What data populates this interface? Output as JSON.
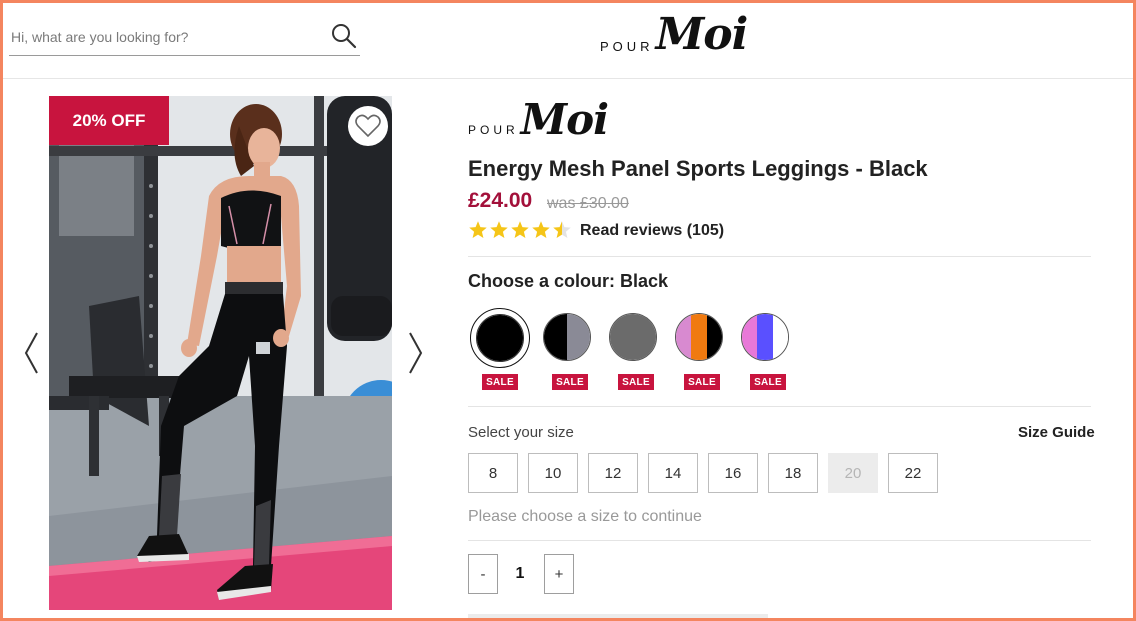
{
  "header": {
    "search_placeholder": "Hi, what are you looking for?",
    "logo_pour": "POUR",
    "logo_moi": "Moi"
  },
  "gallery": {
    "discount_badge": "20% OFF"
  },
  "product": {
    "brand_pour": "POUR",
    "brand_moi": "Moi",
    "title": "Energy Mesh Panel Sports Leggings - Black",
    "price": "£24.00",
    "was_price": "was £30.00",
    "rating": 4.5,
    "rating_max": 5,
    "reviews_link": "Read reviews (105)",
    "colour_label": "Choose a colour: Black",
    "colours": [
      {
        "name": "Black",
        "fill": [
          "#000000"
        ],
        "badge": "SALE",
        "selected": true
      },
      {
        "name": "Black/Grey",
        "fill": [
          "#000000",
          "#8a8a96"
        ],
        "badge": "SALE",
        "selected": false
      },
      {
        "name": "Grey",
        "fill": [
          "#6b6b6b"
        ],
        "badge": "SALE",
        "selected": false
      },
      {
        "name": "Pink/Orange/Black",
        "fill": [
          "#d88ad0",
          "#f07a10",
          "#000000"
        ],
        "badge": "SALE",
        "selected": false
      },
      {
        "name": "Pink/Blue",
        "fill": [
          "#e878d8",
          "#5a50ff",
          "#ffffff"
        ],
        "badge": "SALE",
        "selected": false
      }
    ],
    "size_label": "Select your size",
    "size_guide": "Size Guide",
    "sizes": [
      {
        "label": "8",
        "available": true
      },
      {
        "label": "10",
        "available": true
      },
      {
        "label": "12",
        "available": true
      },
      {
        "label": "14",
        "available": true
      },
      {
        "label": "16",
        "available": true
      },
      {
        "label": "18",
        "available": true
      },
      {
        "label": "20",
        "available": false
      },
      {
        "label": "22",
        "available": true
      }
    ],
    "size_message": "Please choose a size to continue",
    "quantity": {
      "minus": "-",
      "value": "1",
      "plus": "+"
    }
  },
  "colors": {
    "accent": "#c8143e",
    "price": "#a3103a",
    "star": "#f5c518",
    "frame": "#f4855f"
  }
}
